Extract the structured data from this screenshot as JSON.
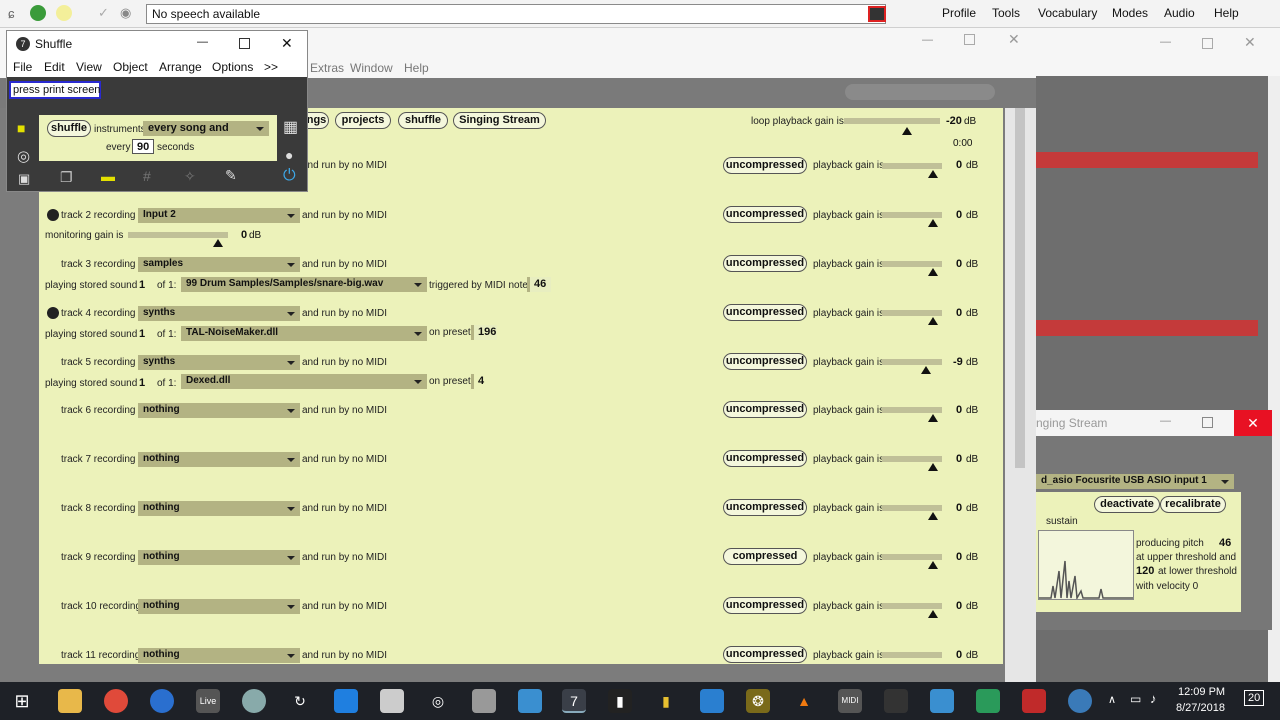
{
  "top_bar": {
    "speech_text": "No speech available",
    "menus": [
      "Profile",
      "Tools",
      "Vocabulary",
      "Modes",
      "Audio",
      "Help"
    ]
  },
  "main_window": {
    "menus_visible": [
      "Extras",
      "Window",
      "Help"
    ]
  },
  "shuffle_window": {
    "title": "Shuffle",
    "menus": [
      "File",
      "Edit",
      "View",
      "Object",
      "Arrange",
      "Options",
      ">>"
    ],
    "print_box": "press print screen",
    "shuffle_button": "shuffle",
    "instruments_label": "instruments",
    "instruments_value": "every song and",
    "every_label": "every",
    "every_value": "90",
    "seconds_label": "seconds"
  },
  "patcher": {
    "header_buttons_partial": "ngs",
    "header_buttons": [
      "projects",
      "shuffle",
      "Singing Stream"
    ],
    "loop_label": "loop playback gain is",
    "loop_gain": "-20",
    "db_unit": "dB",
    "time": "0:00",
    "run_by": "and run by no MIDI",
    "playback_label": "playback gain is",
    "monitoring_label": "monitoring gain is",
    "monitoring_gain": "0",
    "playing_stored": "playing stored sound",
    "of_1": "of 1:",
    "triggered_label": "triggered by MIDI note",
    "on_preset": "on preset",
    "track1_partial": "and run by no MIDI",
    "tracks": [
      {
        "label": "track 2 recording",
        "input": "Input 2",
        "compression": "uncompressed",
        "gain": "0"
      },
      {
        "label": "track 3 recording",
        "input": "samples",
        "compression": "uncompressed",
        "gain": "0",
        "stored_index": "1",
        "stored_file": "99 Drum Samples/Samples/snare-big.wav",
        "midi_note": "46"
      },
      {
        "label": "track 4 recording",
        "input": "synths",
        "compression": "uncompressed",
        "gain": "0",
        "stored_index": "1",
        "stored_file": "TAL-NoiseMaker.dll",
        "preset": "196"
      },
      {
        "label": "track 5 recording",
        "input": "synths",
        "compression": "uncompressed",
        "gain": "-9",
        "stored_index": "1",
        "stored_file": "Dexed.dll",
        "preset": "4"
      },
      {
        "label": "track 6 recording",
        "input": "nothing",
        "compression": "uncompressed",
        "gain": "0"
      },
      {
        "label": "track 7 recording",
        "input": "nothing",
        "compression": "uncompressed",
        "gain": "0"
      },
      {
        "label": "track 8 recording",
        "input": "nothing",
        "compression": "uncompressed",
        "gain": "0"
      },
      {
        "label": "track 9 recording",
        "input": "nothing",
        "compression": "compressed",
        "gain": "0"
      },
      {
        "label": "track 10 recording",
        "input": "nothing",
        "compression": "uncompressed",
        "gain": "0"
      },
      {
        "label": "track 11 recording",
        "input": "nothing",
        "compression": "uncompressed",
        "gain": "0"
      }
    ],
    "track1": {
      "compression": "uncompressed",
      "gain": "0"
    }
  },
  "singing_window": {
    "title": "nging Stream",
    "device": "d_asio Focusrite USB ASIO input 1",
    "deactivate": "deactivate",
    "recalibrate": "recalibrate",
    "sustain": "sustain",
    "producing_label": "producing pitch",
    "pitch": "46",
    "upper_label": "at upper threshold and",
    "upper_value": "120",
    "lower_label": "at lower threshold",
    "velocity_label": "with velocity 0"
  },
  "taskbar": {
    "time": "12:09 PM",
    "date": "8/27/2018",
    "notif_count": "20"
  },
  "colors": {
    "patcher_bg": "#ecf2ba",
    "dropdown": "#b3b383",
    "taskbar": "#1e2127"
  }
}
